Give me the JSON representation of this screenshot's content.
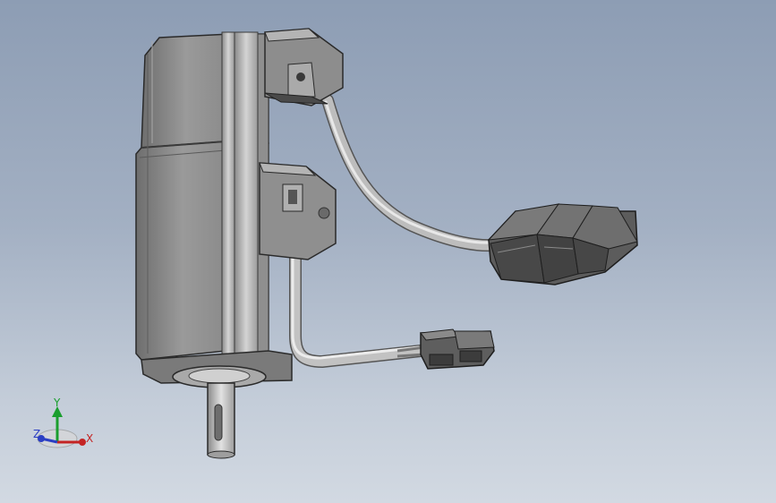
{
  "viewport": {
    "background_top": "#8d9db4",
    "background_bottom": "#d2d9e2"
  },
  "model": {
    "body_color": "#8e8e8e",
    "cable_color": "#bdbdbd",
    "connector_color": "#5a5a5a"
  },
  "triad": {
    "x_label": "X",
    "y_label": "Y",
    "z_label": "Z",
    "x_color": "#c42424",
    "y_color": "#1a9e2e",
    "z_color": "#2b3fc4"
  }
}
